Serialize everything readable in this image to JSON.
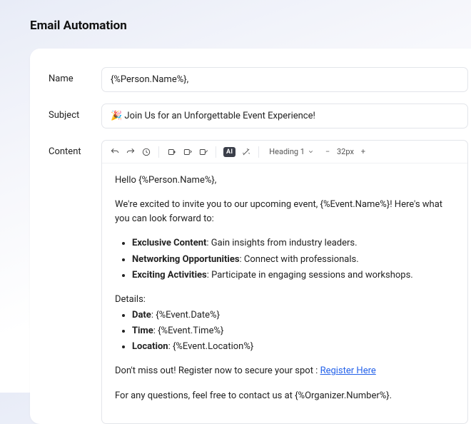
{
  "page": {
    "title": "Email Automation"
  },
  "fields": {
    "name_label": "Name",
    "name_value": "{%Person.Name%},",
    "subject_label": "Subject",
    "subject_value": "🎉 Join Us for an Unforgettable Event Experience!",
    "content_label": "Content"
  },
  "toolbar": {
    "ai_badge": "AI",
    "heading_label": "Heading 1",
    "font_size": "32px"
  },
  "content": {
    "greeting": "Hello {%Person.Name%},",
    "intro": "We're excited to invite you to our upcoming event, {%Event.Name%}! Here's what you can look forward to:",
    "highlights": [
      {
        "b": "Exclusive Content",
        "t": ": Gain insights from industry leaders."
      },
      {
        "b": "Networking Opportunities",
        "t": ": Connect with professionals."
      },
      {
        "b": "Exciting Activities",
        "t": ": Participate in engaging sessions and workshops."
      }
    ],
    "details_heading": "Details:",
    "details": [
      {
        "b": "Date",
        "t": ": {%Event.Date%}"
      },
      {
        "b": "Time",
        "t": ": {%Event.Time%}"
      },
      {
        "b": "Location",
        "t": ": {%Event.Location%}"
      }
    ],
    "cta_prefix": "Don't miss out! Register now to secure your spot : ",
    "cta_link": "Register Here",
    "footer": "For any questions, feel free to contact us at {%Organizer.Number%}."
  }
}
